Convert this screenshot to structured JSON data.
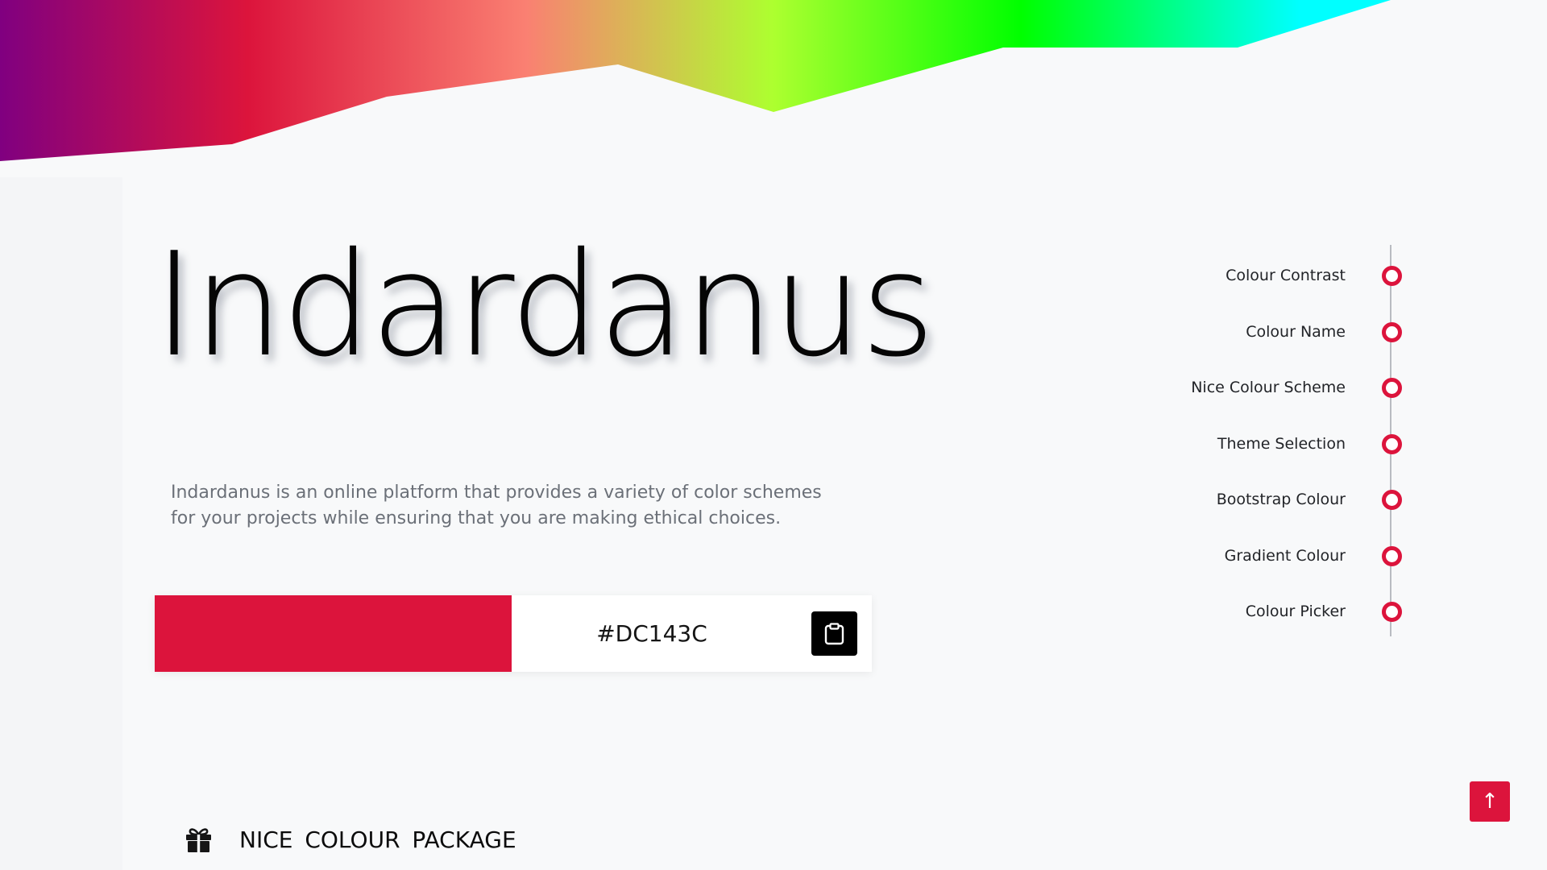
{
  "brand": {
    "title": "Indardanus",
    "description": "Indardanus is an online platform that provides a variety of color schemes for your projects while ensuring that you are making ethical choices."
  },
  "color_card": {
    "hex": "#DC143C",
    "swatch_color": "#DC143C",
    "copy_icon": "clipboard-icon"
  },
  "side_nav": {
    "items": [
      {
        "label": "Colour Contrast"
      },
      {
        "label": "Colour Name"
      },
      {
        "label": "Nice Colour Scheme"
      },
      {
        "label": "Theme Selection"
      },
      {
        "label": "Bootstrap Colour"
      },
      {
        "label": "Gradient Colour"
      },
      {
        "label": "Colour Picker"
      }
    ],
    "dot_color": "#DC143C"
  },
  "back_to_top": {
    "label": "↑",
    "icon": "arrow-up-icon",
    "color": "#DC143C"
  },
  "package": {
    "icon": "gift-icon",
    "title": "NICE COLOUR PACKAGE"
  },
  "banner": {
    "gradient_colors": [
      "#800080",
      "#DC143C",
      "#FA8072",
      "#ADFF2F",
      "#00FF00",
      "#00FFFF"
    ]
  }
}
